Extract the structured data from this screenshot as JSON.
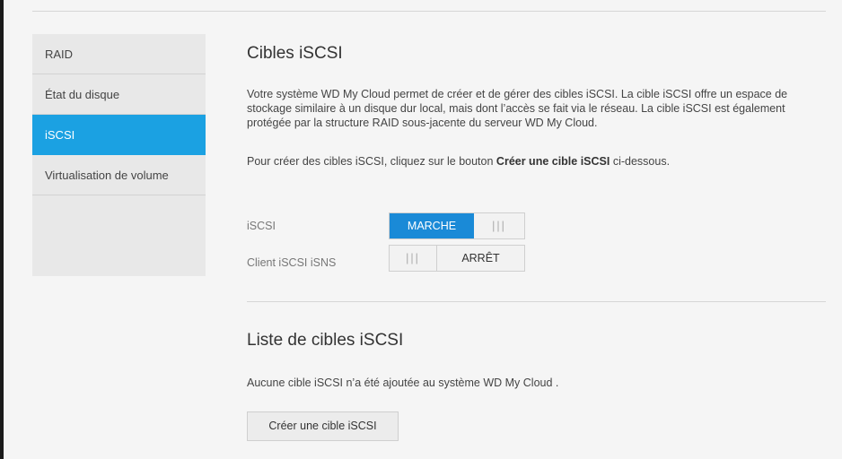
{
  "sidebar": {
    "items": [
      {
        "label": "RAID",
        "active": false
      },
      {
        "label": "État du disque",
        "active": false
      },
      {
        "label": "iSCSI",
        "active": true
      },
      {
        "label": "Virtualisation de volume",
        "active": false
      }
    ]
  },
  "main": {
    "title": "Cibles iSCSI",
    "description": "Votre système WD My Cloud permet de créer et de gérer des cibles iSCSI. La cible iSCSI offre un espace de stockage similaire à un disque dur local, mais dont l’accès se fait via le réseau. La cible iSCSI est également protégée par la structure RAID sous-jacente du serveur WD My Cloud.",
    "instruction_prefix": "Pour créer des cibles iSCSI, cliquez sur le bouton ",
    "instruction_bold": "Créer une cible iSCSI",
    "instruction_suffix": " ci-dessous.",
    "iscsi": {
      "label": "iSCSI",
      "state_text": "MARCHE",
      "grip": "|||",
      "enabled": true
    },
    "isns": {
      "label": "Client iSCSI iSNS",
      "state_text": "ARRÊT",
      "grip": "|||",
      "enabled": false
    },
    "list_title": "Liste de cibles iSCSI",
    "empty_message": "Aucune cible iSCSI n’a été ajoutée au système WD My Cloud .",
    "create_button": "Créer une cible iSCSI"
  },
  "colors": {
    "accent": "#1ba1e2",
    "toggle_on": "#1a8ad7"
  }
}
